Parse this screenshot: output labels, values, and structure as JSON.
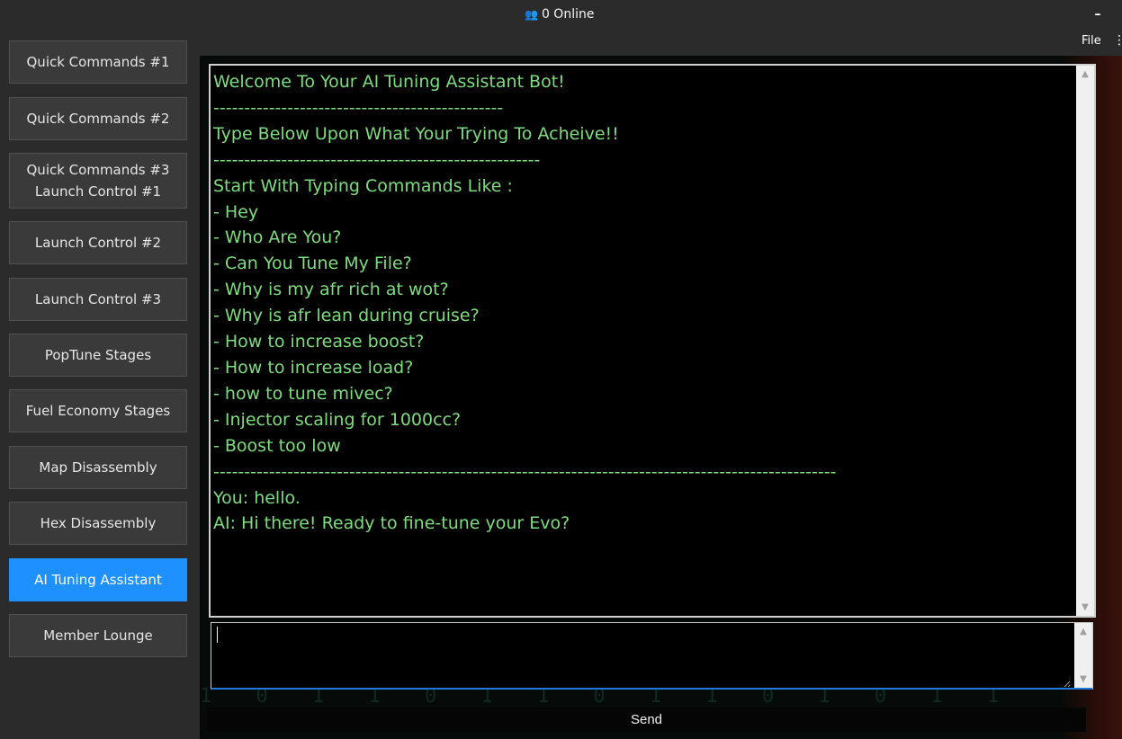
{
  "header": {
    "online_icon": "people-icon",
    "online_text": "0 Online",
    "file_label": "File",
    "minimize_glyph": "–"
  },
  "sidebar": {
    "items": [
      {
        "label": "Quick Commands #1"
      },
      {
        "label": "Quick Commands #2"
      },
      {
        "label": "Quick Commands #3",
        "sublabel": "Launch Control #1"
      },
      {
        "label": "Launch Control #2"
      },
      {
        "label": "Launch Control #3"
      },
      {
        "label": "PopTune Stages"
      },
      {
        "label": "Fuel Economy Stages"
      },
      {
        "label": "Map Disassembly"
      },
      {
        "label": "Hex Disassembly"
      },
      {
        "label": "AI Tuning Assistant",
        "active": true
      },
      {
        "label": "Member Lounge"
      }
    ]
  },
  "chat": {
    "lines": [
      "Welcome To Your AI Tuning Assistant Bot!",
      "-----------------------------------------------",
      "Type Below Upon What Your Trying To Acheive!!",
      "-----------------------------------------------------",
      "Start With Typing Commands Like :",
      "- Hey",
      "- Who Are You?",
      "- Can You Tune My File?",
      "- Why is my afr rich at wot?",
      "- Why is afr lean during cruise?",
      "- How to increase boost?",
      "- How to increase load?",
      "- how to tune mivec?",
      "- Injector scaling for 1000cc?",
      "- Boost too low",
      "-----------------------------------------------------------------------------------------------------",
      "You: hello.",
      "AI: Hi there! Ready to fine-tune your Evo?"
    ],
    "input_value": ""
  },
  "footer": {
    "send_label": "Send"
  },
  "colors": {
    "accent": "#1e90ff",
    "chat_text": "#7ddc7d",
    "panel_bg": "#000000",
    "app_bg": "#2b2b2b"
  }
}
